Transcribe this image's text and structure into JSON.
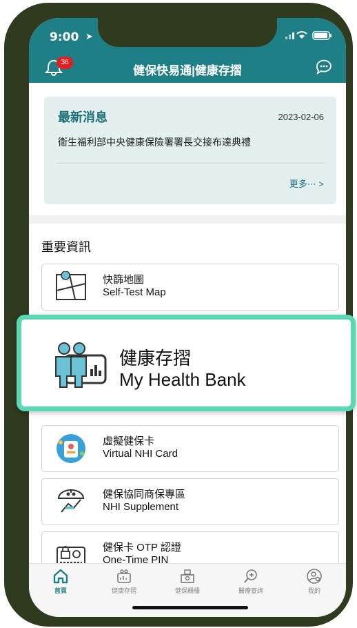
{
  "status": {
    "time": "9:00",
    "icons": "wifi-signal-battery"
  },
  "header": {
    "title": "健保快易通|健康存摺",
    "badge_count": "36"
  },
  "news": {
    "heading": "最新消息",
    "date": "2023-02-06",
    "body": "衛生福利部中央健康保險署署長交接布達典禮",
    "more": "更多⋯ >"
  },
  "section_title": "重要資訊",
  "items": [
    {
      "title": "快篩地圖",
      "subtitle": "Self-Test Map"
    },
    {
      "title": "虛擬健保卡",
      "subtitle": "Virtual NHI Card"
    },
    {
      "title": "健保協同商保專區",
      "subtitle": "NHI Supplement"
    },
    {
      "title": "健保卡 OTP 認證",
      "subtitle": "One-Time PIN"
    }
  ],
  "highlight": {
    "title": "健康存摺",
    "subtitle": "My Health Bank"
  },
  "tabs": [
    {
      "label": "首頁"
    },
    {
      "label": "健康存摺"
    },
    {
      "label": "健保櫃檯"
    },
    {
      "label": "醫療查詢"
    },
    {
      "label": "我的"
    }
  ],
  "colors": {
    "primary": "#1f7f86",
    "highlight": "#5ad8b2",
    "card": "#e3f0ef"
  }
}
